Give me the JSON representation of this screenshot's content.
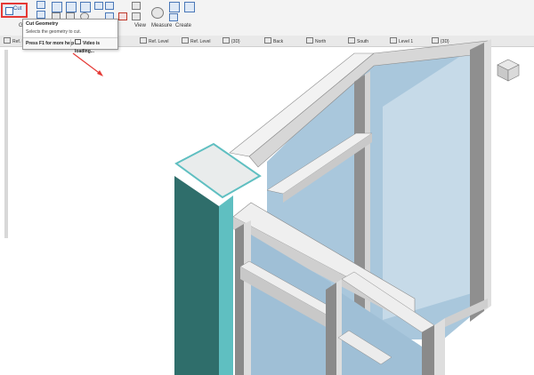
{
  "ribbon": {
    "cut_label": "Cut",
    "panel_labels": [
      "Ge",
      "View",
      "Measure",
      "Create"
    ],
    "icons": [
      "join-icon",
      "split-icon",
      "align-icon",
      "copy-icon",
      "move-icon",
      "rotate-icon",
      "delete-icon",
      "measure-icon",
      "create-icon"
    ]
  },
  "tooltip": {
    "title": "Cut Geometry",
    "description": "Selects the geometry to cut.",
    "help": "Press F1 for more help",
    "video": "Video is loading..."
  },
  "view_tabs": [
    "Ref. Level",
    "Ref. Level",
    "{3D}",
    "Back",
    "North",
    "South",
    "Level 1",
    "{3D}"
  ],
  "colors": {
    "accent_red": "#e53935",
    "column_dark": "#2f6e6b",
    "column_light": "#5fbfc1",
    "glass": "#a9c7dc",
    "mullion": "#b9b9b9"
  }
}
